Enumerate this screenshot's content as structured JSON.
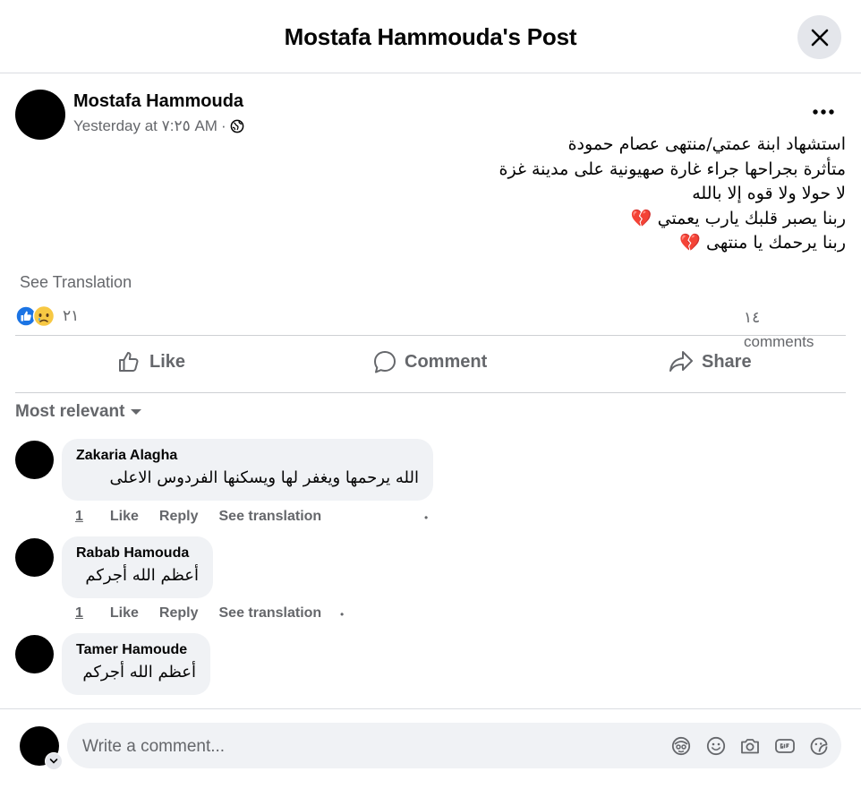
{
  "header": {
    "title": "Mostafa Hammouda's Post"
  },
  "post": {
    "author": "Mostafa Hammouda",
    "timestamp": "Yesterday at ٧:٢٥ AM",
    "separator": "·",
    "lines": [
      "استشهاد ابنة عمتي/منتهى عصام حمودة",
      "متأثرة بجراحها جراء غارة صهيونية على مدينة غزة",
      "لا حولا ولا قوه إلا بالله",
      "ربنا يصبر قلبك يارب يعمتي 💔",
      "ربنا يرحمك يا منتهى 💔"
    ],
    "see_translation": "See Translation",
    "reaction_count": "٢١",
    "comments_count_number": "١٤",
    "comments_count_label": "comments"
  },
  "actions": {
    "like": "Like",
    "comment": "Comment",
    "share": "Share"
  },
  "filter": {
    "label": "Most relevant"
  },
  "comments": [
    {
      "name": "Zakaria Alagha",
      "text": "الله يرحمها ويغفر لها ويسكنها الفردوس الاعلى",
      "time": "1",
      "like": "Like",
      "reply": "Reply",
      "see_translation": "See translation"
    },
    {
      "name": "Rabab Hamouda",
      "text": "أعظم الله أجركم",
      "time": "1",
      "like": "Like",
      "reply": "Reply",
      "see_translation": "See translation"
    },
    {
      "name": "Tamer Hamoude",
      "text": "أعظم الله أجركم"
    }
  ],
  "composer": {
    "placeholder": "Write a comment...",
    "icons": [
      "avatar-sticker-icon",
      "emoji-icon",
      "camera-icon",
      "gif-icon",
      "sticker-icon"
    ]
  },
  "colors": {
    "like_blue": "#1b74e4",
    "reaction_yellow": "#f7c843",
    "secondary_text": "#65676b",
    "bubble_bg": "#f0f2f5"
  }
}
